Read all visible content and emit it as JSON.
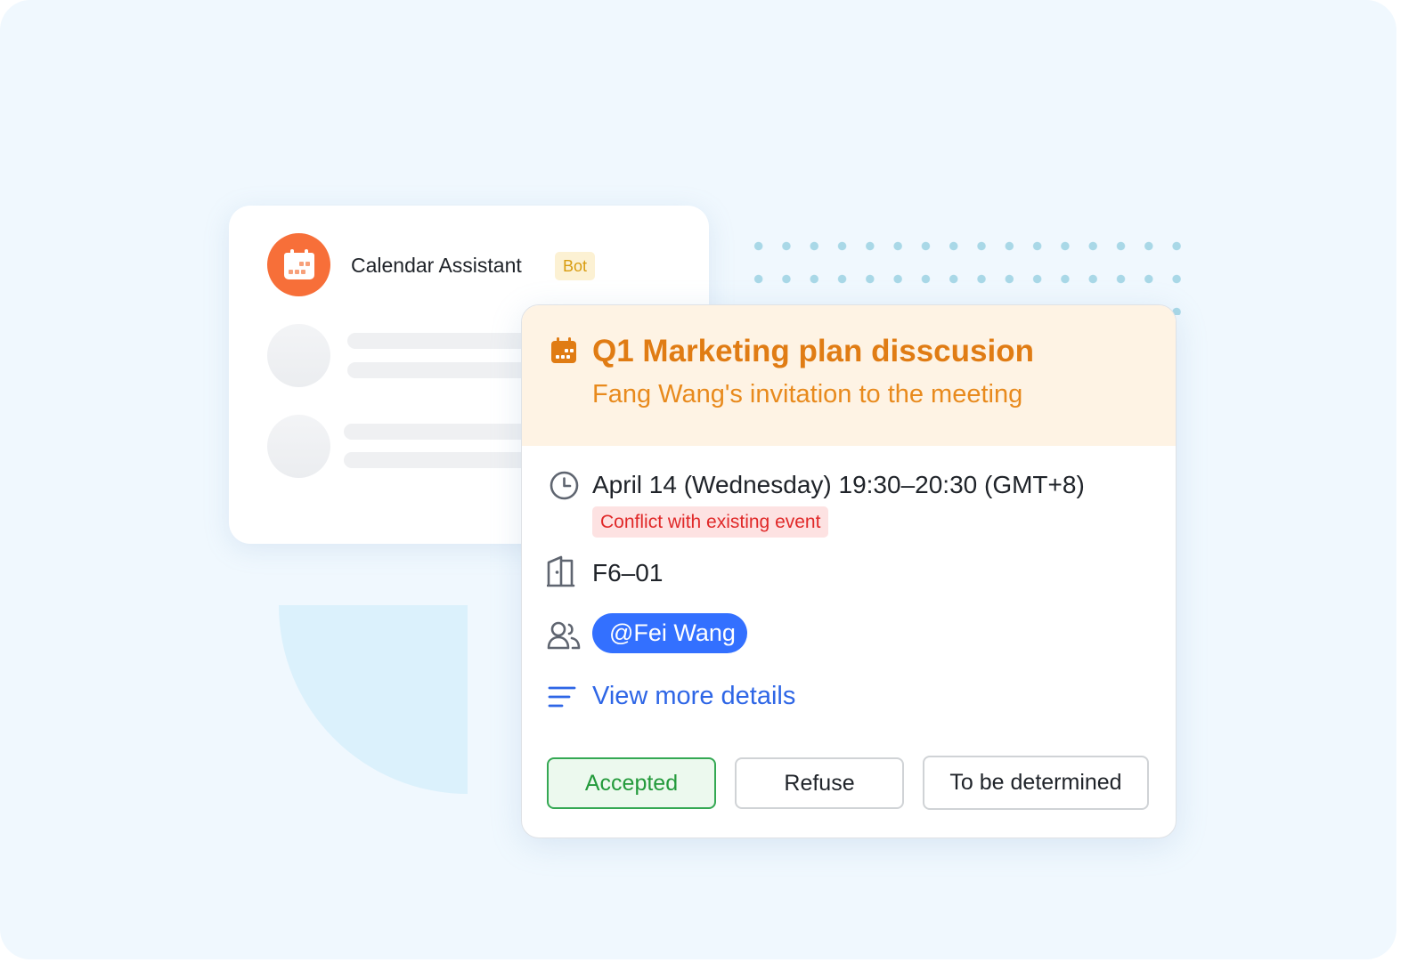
{
  "chat": {
    "bot_name": "Calendar Assistant",
    "bot_tag": "Bot"
  },
  "event": {
    "title": "Q1 Marketing plan disscusion",
    "subtitle": "Fang Wang's invitation to the meeting",
    "time": "April 14 (Wednesday) 19:30–20:30  (GMT+8)",
    "conflict": "Conflict with existing event",
    "room": "F6–01",
    "attendee": "@Fei Wang",
    "more_details": "View more details"
  },
  "actions": {
    "accept": "Accepted",
    "refuse": "Refuse",
    "tbd": "To be determined"
  },
  "icons": {
    "bot_avatar": "calendar-icon",
    "header": "calendar-icon",
    "time": "clock-icon",
    "room": "door-icon",
    "attendees": "users-icon",
    "details": "list-icon"
  },
  "colors": {
    "background": "#f0f8fe",
    "bot_avatar": "#f76f39",
    "header_bg": "#fef3e4",
    "title": "#e07c14",
    "conflict_bg": "#fde2e2",
    "conflict_text": "#e02828",
    "mention": "#3370ff",
    "link": "#2e66e6",
    "accept_border": "#34a853"
  }
}
